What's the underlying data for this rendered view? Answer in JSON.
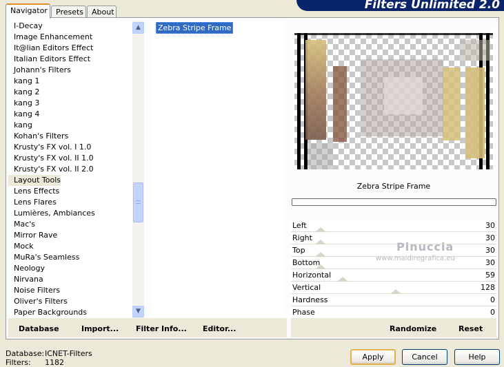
{
  "tabs": [
    {
      "label": "Navigator",
      "active": true
    },
    {
      "label": "Presets",
      "active": false
    },
    {
      "label": "About",
      "active": false
    }
  ],
  "banner_title": "Filters Unlimited 2.0",
  "categories": [
    "I-Decay",
    "Image Enhancement",
    "It@lian Editors Effect",
    "Italian Editors Effect",
    "Johann's Filters",
    "kang 1",
    "kang 2",
    "kang 3",
    "kang 4",
    "kang",
    "Kohan's Filters",
    "Krusty's FX vol. I 1.0",
    "Krusty's FX vol. II 1.0",
    "Krusty's FX vol. II 2.0",
    "Layout Tools",
    "Lens Effects",
    "Lens Flares",
    "Lumières, Ambiances",
    "Mac's",
    "Mirror Rave",
    "Mock",
    "MuRa's Seamless",
    "Neology",
    "Nirvana",
    "Noise Filters",
    "Oliver's Filters",
    "Paper Backgrounds"
  ],
  "selected_category": "Layout Tools",
  "filters": [
    "Zebra Stripe Frame"
  ],
  "bottom_buttons": {
    "database": "Database",
    "import": "Import...",
    "filter_info": "Filter Info...",
    "editor": "Editor..."
  },
  "filter_name": "Zebra Stripe Frame",
  "params": [
    {
      "label": "Left",
      "value": "30"
    },
    {
      "label": "Right",
      "value": "30"
    },
    {
      "label": "Top",
      "value": "30"
    },
    {
      "label": "Bottom",
      "value": "30"
    },
    {
      "label": "Horizontal",
      "value": "59"
    },
    {
      "label": "Vertical",
      "value": "128"
    },
    {
      "label": "Hardness",
      "value": "0"
    },
    {
      "label": "Phase",
      "value": "0"
    }
  ],
  "right_buttons": {
    "randomize": "Randomize",
    "reset": "Reset"
  },
  "watermark": {
    "name": "Pinuccia",
    "url": "www.maidiregrafica.eu"
  },
  "status": {
    "database_label": "Database:",
    "database_value": "ICNET-Filters",
    "filters_label": "Filters:",
    "filters_value": "1182"
  },
  "dialog_buttons": {
    "apply": "Apply",
    "cancel": "Cancel",
    "help": "Help"
  }
}
